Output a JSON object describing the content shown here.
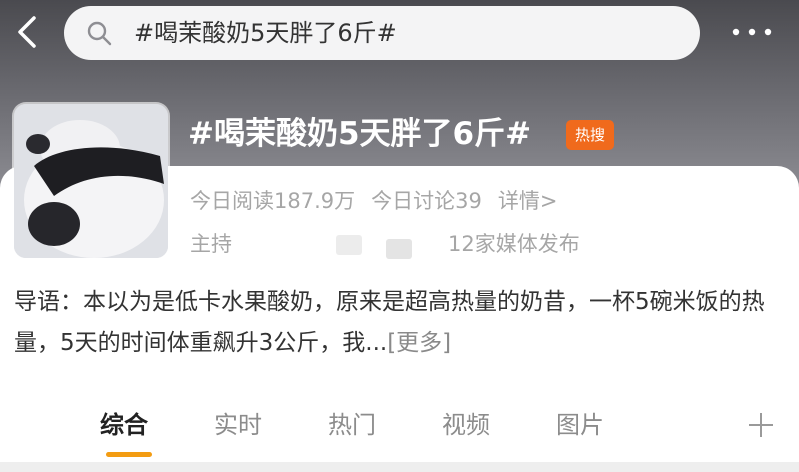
{
  "search": {
    "query": "#喝茉酸奶5天胖了6斤#"
  },
  "topic": {
    "title": "#喝茉酸奶5天胖了6斤#",
    "badge": "热搜",
    "stats": {
      "reads": "今日阅读187.9万",
      "discussions": "今日讨论39",
      "details": "详情>"
    },
    "host_label": "主持",
    "media_text": "12家媒体发布"
  },
  "intro": {
    "text": "导语：本以为是低卡水果酸奶，原来是超高热量的奶昔，一杯5碗米饭的热量，5天的时间体重飙升3公斤，我...",
    "more": "[更多]"
  },
  "tabs": [
    {
      "label": "综合",
      "active": true
    },
    {
      "label": "实时",
      "active": false
    },
    {
      "label": "热门",
      "active": false
    },
    {
      "label": "视频",
      "active": false
    },
    {
      "label": "图片",
      "active": false
    }
  ],
  "colors": {
    "accent": "#f39c12",
    "badge": "#f06a1c"
  }
}
